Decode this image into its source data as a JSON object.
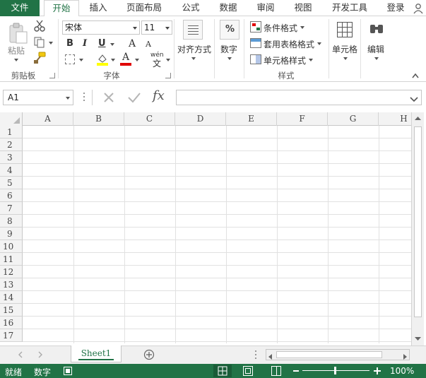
{
  "ribbon_tabs": [
    {
      "label": "文件"
    },
    {
      "label": "开始"
    },
    {
      "label": "插入"
    },
    {
      "label": "页面布局"
    },
    {
      "label": "公式"
    },
    {
      "label": "数据"
    },
    {
      "label": "审阅"
    },
    {
      "label": "视图"
    },
    {
      "label": "开发工具"
    },
    {
      "label": "登录"
    }
  ],
  "clipboard": {
    "paste_label": "粘贴",
    "group_label": "剪贴板"
  },
  "font": {
    "name": "宋体",
    "size": "11",
    "group_label": "字体",
    "bold": "B",
    "italic": "I",
    "underline": "U",
    "grow": "A",
    "shrink": "A",
    "phonetic": "wén",
    "font_color_letter": "A"
  },
  "alignment": {
    "label": "对齐方式"
  },
  "number": {
    "label": "数字",
    "symbol": "%"
  },
  "styles": {
    "conditional": "条件格式",
    "table": "套用表格格式",
    "cell": "单元格样式",
    "group_label": "样式"
  },
  "cells": {
    "label": "单元格"
  },
  "editing": {
    "label": "编辑"
  },
  "formula_bar": {
    "cell_ref": "A1",
    "fx": "fx",
    "value": ""
  },
  "columns": [
    "A",
    "B",
    "C",
    "D",
    "E",
    "F",
    "G",
    "H"
  ],
  "rows": [
    "1",
    "2",
    "3",
    "4",
    "5",
    "6",
    "7",
    "8",
    "9",
    "10",
    "11",
    "12",
    "13",
    "14",
    "15",
    "16",
    "17"
  ],
  "sheets": [
    {
      "name": "Sheet1"
    }
  ],
  "status": {
    "ready": "就绪",
    "mode": "数字",
    "zoom": "100%"
  },
  "colors": {
    "accent": "#217346",
    "grid": "#e1e1e1",
    "header_bg": "#f3f3f3"
  }
}
